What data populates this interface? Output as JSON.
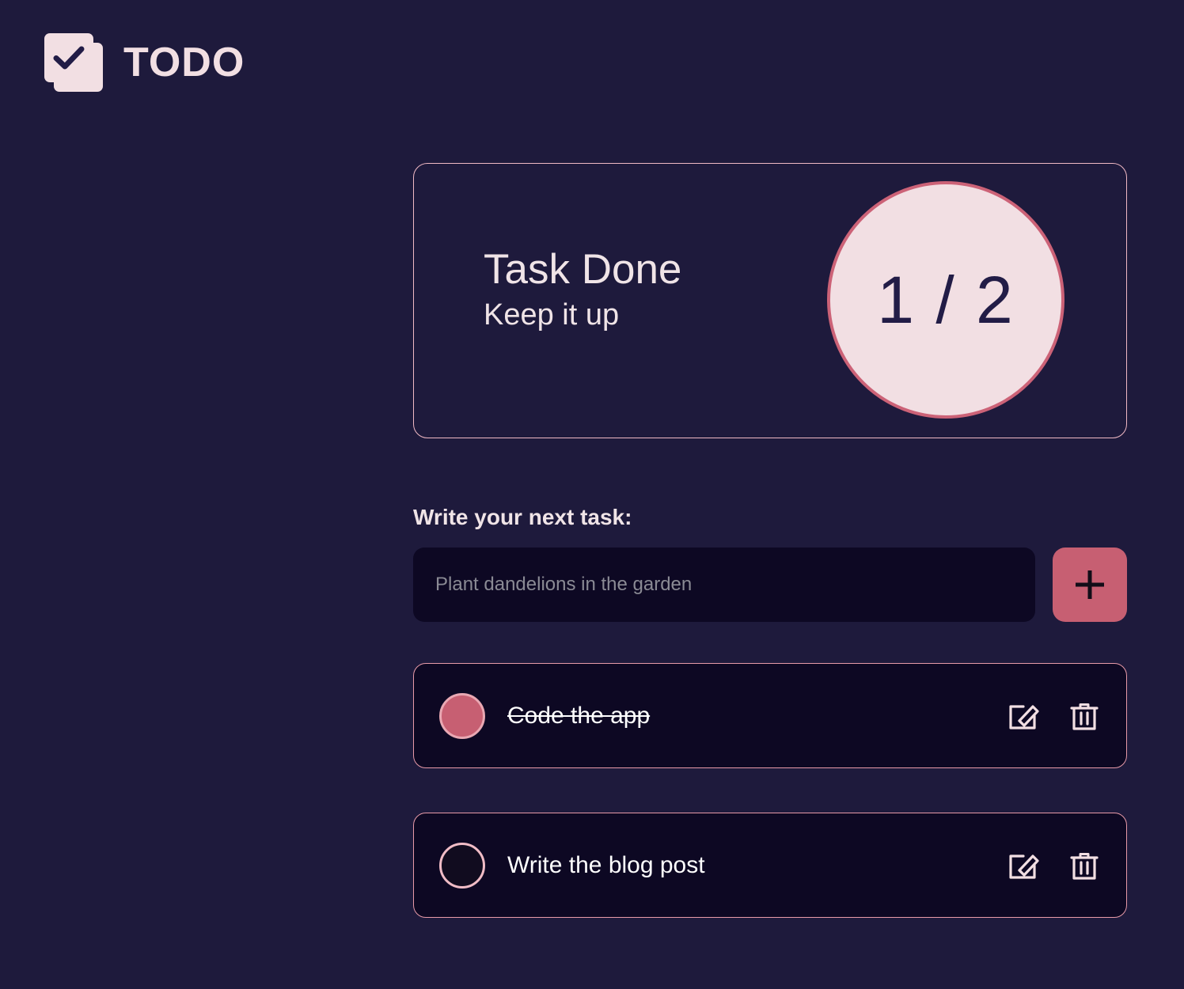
{
  "app": {
    "brand_title": "TODO",
    "logo_icon": "checkbox-stack-icon"
  },
  "stats": {
    "title": "Task Done",
    "subtitle": "Keep it up",
    "progress_text": "1 / 2",
    "completed_count": 1,
    "total_count": 2
  },
  "input": {
    "label": "Write your next task:",
    "value": "",
    "placeholder": "Plant dandelions in the garden",
    "add_icon": "plus-icon"
  },
  "tasks": [
    {
      "label": "Code the app",
      "done": true,
      "edit_icon": "edit-pencil-icon",
      "delete_icon": "trash-icon"
    },
    {
      "label": "Write the blog post",
      "done": false,
      "edit_icon": "edit-pencil-icon",
      "delete_icon": "trash-icon"
    }
  ],
  "colors": {
    "background": "#1e1a3c",
    "panel": "#0d0823",
    "accent_rose": "#c75f72",
    "pink_soft": "#f2dfe3",
    "card_border": "#f0b9c4"
  }
}
